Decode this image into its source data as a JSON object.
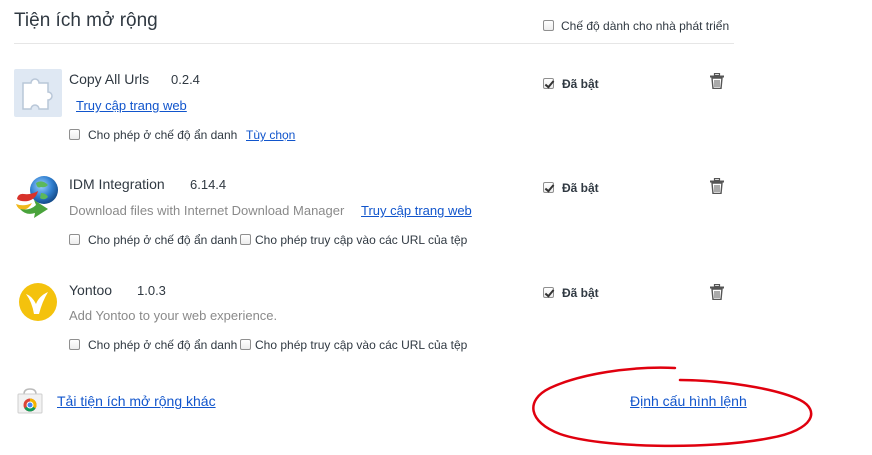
{
  "page": {
    "title": "Tiện ích mở rộng"
  },
  "developer_mode": {
    "label": "Chế độ dành cho nhà phát triển",
    "checked": false
  },
  "extensions": [
    {
      "name": "Copy All Urls",
      "version": "0.2.4",
      "description": "",
      "link": "Truy cập trang web",
      "incognito_label": "Cho phép ở chế độ ẩn danh",
      "options_link": "Tùy chọn",
      "enabled_label": "Đã bật",
      "icon": "puzzle-icon"
    },
    {
      "name": "IDM Integration",
      "version": "6.14.4",
      "description": "Download files with Internet Download Manager",
      "link": "Truy cập trang web",
      "incognito_label": "Cho phép ở chế độ ẩn danh",
      "file_url_label": "Cho phép truy cập vào các URL của tệp",
      "enabled_label": "Đã bật",
      "icon": "idm-globe-icon"
    },
    {
      "name": "Yontoo",
      "version": "1.0.3",
      "description": "Add Yontoo to your web experience.",
      "incognito_label": "Cho phép ở chế độ ẩn danh",
      "file_url_label": "Cho phép truy cập vào các URL của tệp",
      "enabled_label": "Đã bật",
      "icon": "yontoo-icon"
    }
  ],
  "footer": {
    "get_more_link": "Tải tiện ích mở rộng khác",
    "keyboard_shortcuts_link": "Định cấu hình lệnh"
  },
  "colors": {
    "link": "#1155cc",
    "annotation": "#e0000e"
  }
}
